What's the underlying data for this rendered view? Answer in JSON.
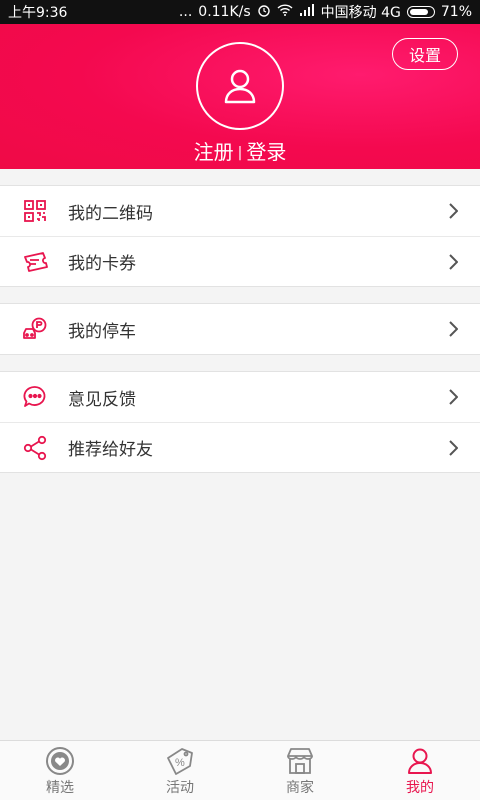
{
  "status_bar": {
    "time": "上午9:36",
    "dots": "...",
    "net_speed": "0.11K/s",
    "carrier": "中国移动 4G",
    "battery": "71%"
  },
  "header": {
    "settings_label": "设置",
    "register_label": "注册",
    "separator": "|",
    "login_label": "登录"
  },
  "menu": {
    "group1": [
      {
        "label": "我的二维码",
        "icon": "qr-code-icon"
      },
      {
        "label": "我的卡券",
        "icon": "ticket-icon"
      }
    ],
    "group2": [
      {
        "label": "我的停车",
        "icon": "parking-car-icon"
      }
    ],
    "group3": [
      {
        "label": "意见反馈",
        "icon": "chat-bubble-icon"
      },
      {
        "label": "推荐给好友",
        "icon": "share-icon"
      }
    ]
  },
  "bottom_nav": [
    {
      "label": "精选",
      "icon": "heart-circle-icon"
    },
    {
      "label": "活动",
      "icon": "percent-tag-icon"
    },
    {
      "label": "商家",
      "icon": "store-icon"
    },
    {
      "label": "我的",
      "icon": "user-icon",
      "active": true
    }
  ],
  "colors": {
    "accent": "#e8164f",
    "header_bg": "#f4094f",
    "icon": "#e8164f"
  }
}
